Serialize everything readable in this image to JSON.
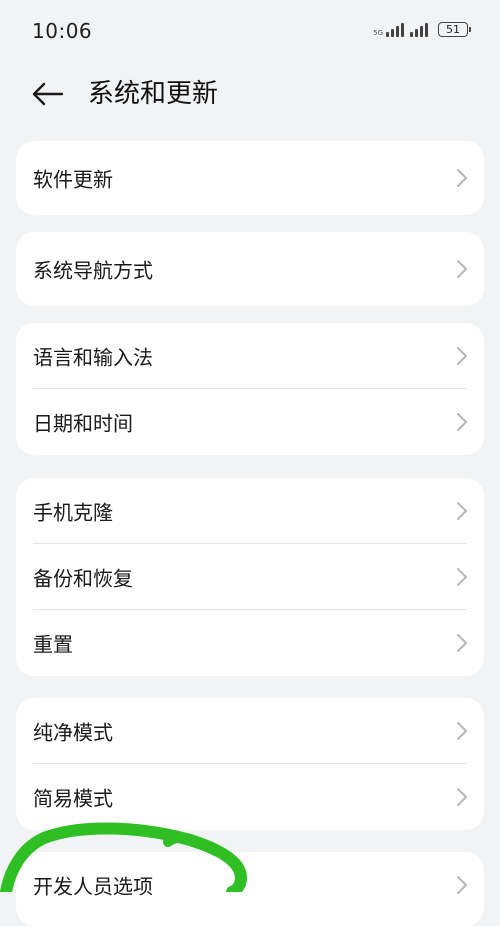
{
  "status_bar": {
    "time": "10:06",
    "battery_level": "51",
    "signal_small_label": "5G"
  },
  "header": {
    "title": "系统和更新"
  },
  "groups": [
    {
      "items": [
        {
          "label": "软件更新"
        }
      ]
    },
    {
      "items": [
        {
          "label": "系统导航方式"
        }
      ]
    },
    {
      "items": [
        {
          "label": "语言和输入法"
        },
        {
          "label": "日期和时间"
        }
      ]
    },
    {
      "items": [
        {
          "label": "手机克隆"
        },
        {
          "label": "备份和恢复"
        },
        {
          "label": "重置"
        }
      ]
    },
    {
      "items": [
        {
          "label": "纯净模式"
        },
        {
          "label": "简易模式"
        }
      ]
    },
    {
      "items": [
        {
          "label": "开发人员选项"
        }
      ]
    }
  ],
  "colors": {
    "background": "#f1f3f5",
    "card": "#ffffff",
    "annotation_stroke": "#2fbf24"
  },
  "icons": {
    "back": "arrow-left-icon",
    "row": "chevron-right-icon"
  }
}
